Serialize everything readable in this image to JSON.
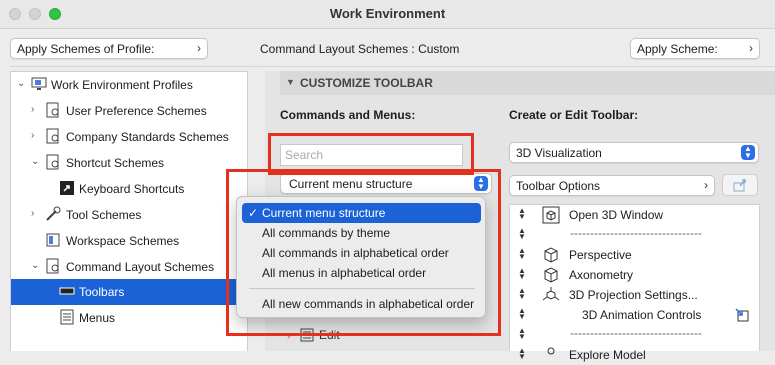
{
  "window": {
    "title": "Work Environment"
  },
  "top": {
    "apply_profile_label": "Apply Schemes of Profile:",
    "layout_scheme_text": "Command Layout Schemes : Custom",
    "apply_scheme_label": "Apply Scheme:"
  },
  "tree": {
    "items": [
      {
        "label": "Work Environment Profiles"
      },
      {
        "label": "User Preference Schemes"
      },
      {
        "label": "Company Standards Schemes"
      },
      {
        "label": "Shortcut Schemes"
      },
      {
        "label": "Keyboard Shortcuts"
      },
      {
        "label": "Tool Schemes"
      },
      {
        "label": "Workspace Schemes"
      },
      {
        "label": "Command Layout Schemes"
      },
      {
        "label": "Toolbars"
      },
      {
        "label": "Menus"
      }
    ]
  },
  "customize": {
    "header": "CUSTOMIZE TOOLBAR",
    "commands_label": "Commands and Menus:",
    "create_label": "Create or Edit Toolbar:",
    "search_placeholder": "Search",
    "structure_value": "Current menu structure",
    "toolbar_value": "3D Visualization",
    "toolbar_options_label": "Toolbar Options",
    "partial_row_label": "Edit"
  },
  "menu": {
    "check": "✓",
    "items": [
      "Current menu structure",
      "All commands by theme",
      "All commands in alphabetical order",
      "All menus in alphabetical order",
      "All new commands in alphabetical order"
    ]
  },
  "toolbar_items": {
    "open3d": "Open 3D Window",
    "sep": "---------------------------------",
    "perspective": "Perspective",
    "axonometry": "Axonometry",
    "projection": "3D Projection Settings...",
    "animation": "3D Animation Controls",
    "partial": "Explore Model"
  },
  "colors": {
    "selection": "#1a62d6",
    "highlight_box": "#e5301f",
    "accent": "#2a6ee8"
  }
}
